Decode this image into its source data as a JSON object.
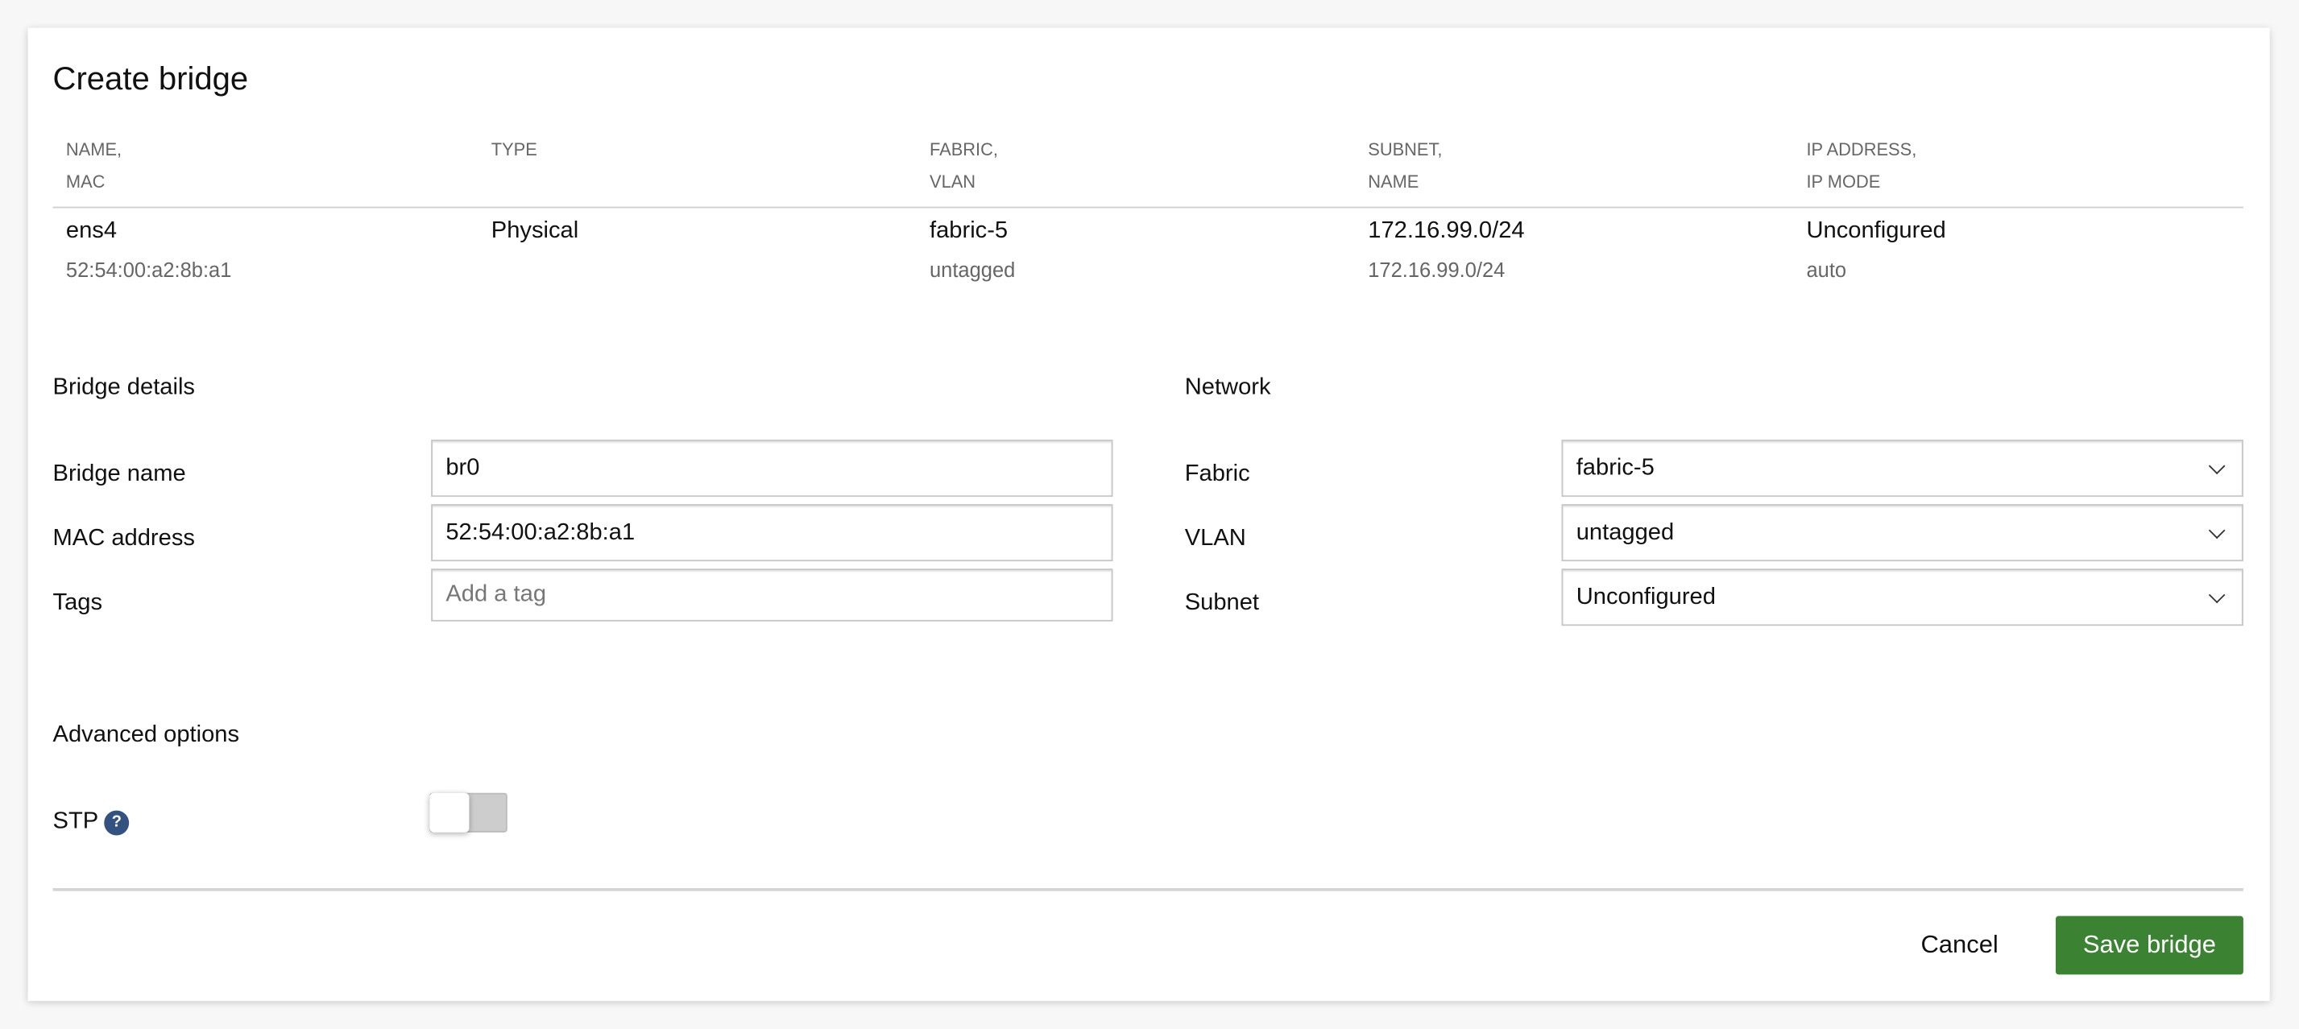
{
  "title": "Create bridge",
  "table": {
    "headers": [
      {
        "line1": "NAME,",
        "line2": "MAC"
      },
      {
        "line1": "TYPE",
        "line2": ""
      },
      {
        "line1": "FABRIC,",
        "line2": "VLAN"
      },
      {
        "line1": "SUBNET,",
        "line2": "NAME"
      },
      {
        "line1": "IP ADDRESS,",
        "line2": "IP MODE"
      }
    ],
    "row": [
      {
        "primary": "ens4",
        "secondary": "52:54:00:a2:8b:a1"
      },
      {
        "primary": "Physical",
        "secondary": ""
      },
      {
        "primary": "fabric-5",
        "secondary": "untagged"
      },
      {
        "primary": "172.16.99.0/24",
        "secondary": "172.16.99.0/24"
      },
      {
        "primary": "Unconfigured",
        "secondary": "auto"
      }
    ]
  },
  "bridge_details": {
    "heading": "Bridge details",
    "bridge_name_label": "Bridge name",
    "bridge_name_value": "br0",
    "mac_label": "MAC address",
    "mac_value": "52:54:00:a2:8b:a1",
    "tags_label": "Tags",
    "tags_placeholder": "Add a tag"
  },
  "network": {
    "heading": "Network",
    "fabric_label": "Fabric",
    "fabric_value": "fabric-5",
    "vlan_label": "VLAN",
    "vlan_value": "untagged",
    "subnet_label": "Subnet",
    "subnet_value": "Unconfigured"
  },
  "advanced": {
    "heading": "Advanced options",
    "stp_label": "STP",
    "stp_help": "?",
    "stp_enabled": false
  },
  "footer": {
    "cancel_label": "Cancel",
    "save_label": "Save bridge"
  },
  "colors": {
    "primary_button": "#3b8332",
    "help_icon": "#335280"
  }
}
